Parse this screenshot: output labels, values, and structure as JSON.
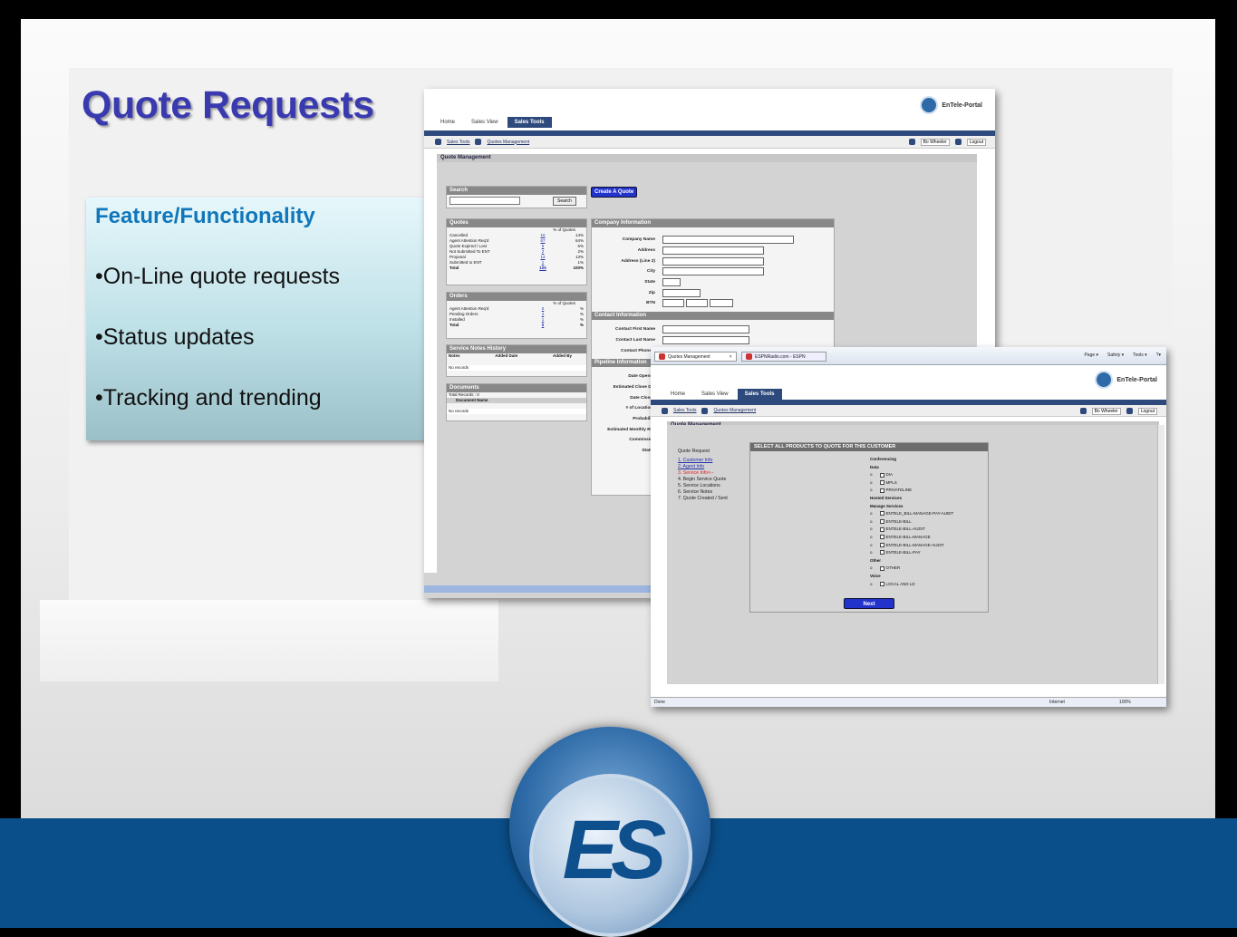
{
  "slide": {
    "title": "Quote Requests",
    "feature_title": "Feature/Functionality",
    "features": [
      "•On-Line quote requests",
      "•Status updates",
      "•Tracking and trending"
    ],
    "logo_text": "ES"
  },
  "portal": {
    "brand": "EnTele-Portal",
    "tabs": [
      "Home",
      "Sales View",
      "Sales Tools"
    ],
    "active_tab": "Sales Tools",
    "breadcrumb": [
      "Sales Tools",
      "Quotes Management"
    ],
    "user_label": "Bo Wheeler",
    "logout_label": "Logout",
    "section_title": "Quote Management"
  },
  "shot1": {
    "search": {
      "title": "Search",
      "button": "Search"
    },
    "create_button": "Create A Quote",
    "quotes": {
      "title": "Quotes",
      "col_header": "% of Quotes",
      "rows": [
        {
          "label": "Cancelled",
          "count": "15",
          "pct": "14%"
        },
        {
          "label": "Agent Attention Req'd",
          "count": "67",
          "pct": "64%"
        },
        {
          "label": "Quote Expired / Lost",
          "count": "6",
          "pct": "6%"
        },
        {
          "label": "Not Submitted To ENT",
          "count": "2",
          "pct": "2%"
        },
        {
          "label": "Proposal",
          "count": "14",
          "pct": "13%"
        },
        {
          "label": "Submitted to ENT",
          "count": "1",
          "pct": "1%"
        },
        {
          "label": "Total",
          "count": "105",
          "pct": "100%"
        }
      ]
    },
    "orders": {
      "title": "Orders",
      "col_header": "% of Quotes",
      "rows": [
        {
          "label": "Agent Attention Req'd",
          "count": "0",
          "pct": "%"
        },
        {
          "label": "Pending Orders",
          "count": "4",
          "pct": "%"
        },
        {
          "label": "Installed",
          "count": "1",
          "pct": "%"
        },
        {
          "label": "Total",
          "count": "5",
          "pct": "%"
        }
      ]
    },
    "service_notes": {
      "title": "Service Notes History",
      "cols": [
        "Notes",
        "Added Date",
        "Added By"
      ],
      "empty": "No records"
    },
    "documents": {
      "title": "Documents",
      "total": "Total Records : 0",
      "col": "Document Name",
      "empty": "No records"
    },
    "company": {
      "title": "Company Information",
      "fields": [
        "Company Name",
        "Address",
        "Address (Line 2)",
        "City",
        "State",
        "Zip",
        "BTN"
      ]
    },
    "contact": {
      "title": "Contact Information",
      "fields": [
        "Contact First Name",
        "Contact Last Name",
        "Contact Phone #"
      ]
    },
    "pipeline": {
      "title": "Pipeline Information",
      "fields": [
        "Date Opened",
        "Estimated Close Dat",
        "Date Closed",
        "# of Locations",
        "Probability",
        "Estimated Monthly Rev",
        "Commission",
        "Status"
      ]
    }
  },
  "shot2": {
    "browser_tabs": [
      "Quotes Management",
      "ESPNRadio.com - ESPN"
    ],
    "toolbar": [
      "Page ▾",
      "Safety ▾",
      "Tools ▾",
      "?▾"
    ],
    "status_left": "Done",
    "status_zone": "Internet",
    "zoom": "100%",
    "quote_request": {
      "title": "Quote Request",
      "steps": [
        {
          "text": "1.  Customer Info",
          "style": "link"
        },
        {
          "text": "2.  Agent Info",
          "style": "link"
        },
        {
          "text": "3.  Service Info<--",
          "style": "current"
        },
        {
          "text": "4.  Begin Service Quote",
          "style": "plain"
        },
        {
          "text": "5.  Service Locations",
          "style": "plain"
        },
        {
          "text": "6.  Service Notes",
          "style": "plain"
        },
        {
          "text": "7.  Quote Created / Sent",
          "style": "plain"
        }
      ]
    },
    "products": {
      "title": "SELECT ALL PRODUCTS TO QUOTE FOR THIS CUSTOMER",
      "groups": [
        {
          "name": "Conferencing",
          "items": []
        },
        {
          "name": "Data",
          "items": [
            "DIA",
            "MPLS",
            "PRIVATELINE"
          ]
        },
        {
          "name": "Hosted Services",
          "items": []
        },
        {
          "name": "Manage Services",
          "items": [
            "ENTELE_BILL-MANAGE-PAY-AUDIT",
            "ENTELE-BILL",
            "ENTELE-BILL-AUDIT",
            "ENTELE-BILL-MANAGE",
            "ENTELE-BILL-MANAGE-AUDIT",
            "ENTELE-BILL-PAY"
          ]
        },
        {
          "name": "Other",
          "items": [
            "OTHER"
          ]
        },
        {
          "name": "Voice",
          "items": [
            "LOCAL AND LD"
          ]
        }
      ],
      "next_button": "Next"
    }
  }
}
